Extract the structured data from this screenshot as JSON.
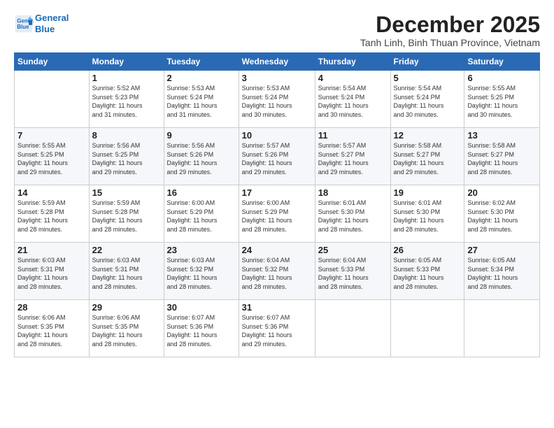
{
  "header": {
    "logo_line1": "General",
    "logo_line2": "Blue",
    "month": "December 2025",
    "location": "Tanh Linh, Binh Thuan Province, Vietnam"
  },
  "days_of_week": [
    "Sunday",
    "Monday",
    "Tuesday",
    "Wednesday",
    "Thursday",
    "Friday",
    "Saturday"
  ],
  "weeks": [
    [
      {
        "num": "",
        "info": ""
      },
      {
        "num": "1",
        "info": "Sunrise: 5:52 AM\nSunset: 5:23 PM\nDaylight: 11 hours\nand 31 minutes."
      },
      {
        "num": "2",
        "info": "Sunrise: 5:53 AM\nSunset: 5:24 PM\nDaylight: 11 hours\nand 31 minutes."
      },
      {
        "num": "3",
        "info": "Sunrise: 5:53 AM\nSunset: 5:24 PM\nDaylight: 11 hours\nand 30 minutes."
      },
      {
        "num": "4",
        "info": "Sunrise: 5:54 AM\nSunset: 5:24 PM\nDaylight: 11 hours\nand 30 minutes."
      },
      {
        "num": "5",
        "info": "Sunrise: 5:54 AM\nSunset: 5:24 PM\nDaylight: 11 hours\nand 30 minutes."
      },
      {
        "num": "6",
        "info": "Sunrise: 5:55 AM\nSunset: 5:25 PM\nDaylight: 11 hours\nand 30 minutes."
      }
    ],
    [
      {
        "num": "7",
        "info": "Sunrise: 5:55 AM\nSunset: 5:25 PM\nDaylight: 11 hours\nand 29 minutes."
      },
      {
        "num": "8",
        "info": "Sunrise: 5:56 AM\nSunset: 5:25 PM\nDaylight: 11 hours\nand 29 minutes."
      },
      {
        "num": "9",
        "info": "Sunrise: 5:56 AM\nSunset: 5:26 PM\nDaylight: 11 hours\nand 29 minutes."
      },
      {
        "num": "10",
        "info": "Sunrise: 5:57 AM\nSunset: 5:26 PM\nDaylight: 11 hours\nand 29 minutes."
      },
      {
        "num": "11",
        "info": "Sunrise: 5:57 AM\nSunset: 5:27 PM\nDaylight: 11 hours\nand 29 minutes."
      },
      {
        "num": "12",
        "info": "Sunrise: 5:58 AM\nSunset: 5:27 PM\nDaylight: 11 hours\nand 29 minutes."
      },
      {
        "num": "13",
        "info": "Sunrise: 5:58 AM\nSunset: 5:27 PM\nDaylight: 11 hours\nand 28 minutes."
      }
    ],
    [
      {
        "num": "14",
        "info": "Sunrise: 5:59 AM\nSunset: 5:28 PM\nDaylight: 11 hours\nand 28 minutes."
      },
      {
        "num": "15",
        "info": "Sunrise: 5:59 AM\nSunset: 5:28 PM\nDaylight: 11 hours\nand 28 minutes."
      },
      {
        "num": "16",
        "info": "Sunrise: 6:00 AM\nSunset: 5:29 PM\nDaylight: 11 hours\nand 28 minutes."
      },
      {
        "num": "17",
        "info": "Sunrise: 6:00 AM\nSunset: 5:29 PM\nDaylight: 11 hours\nand 28 minutes."
      },
      {
        "num": "18",
        "info": "Sunrise: 6:01 AM\nSunset: 5:30 PM\nDaylight: 11 hours\nand 28 minutes."
      },
      {
        "num": "19",
        "info": "Sunrise: 6:01 AM\nSunset: 5:30 PM\nDaylight: 11 hours\nand 28 minutes."
      },
      {
        "num": "20",
        "info": "Sunrise: 6:02 AM\nSunset: 5:30 PM\nDaylight: 11 hours\nand 28 minutes."
      }
    ],
    [
      {
        "num": "21",
        "info": "Sunrise: 6:03 AM\nSunset: 5:31 PM\nDaylight: 11 hours\nand 28 minutes."
      },
      {
        "num": "22",
        "info": "Sunrise: 6:03 AM\nSunset: 5:31 PM\nDaylight: 11 hours\nand 28 minutes."
      },
      {
        "num": "23",
        "info": "Sunrise: 6:03 AM\nSunset: 5:32 PM\nDaylight: 11 hours\nand 28 minutes."
      },
      {
        "num": "24",
        "info": "Sunrise: 6:04 AM\nSunset: 5:32 PM\nDaylight: 11 hours\nand 28 minutes."
      },
      {
        "num": "25",
        "info": "Sunrise: 6:04 AM\nSunset: 5:33 PM\nDaylight: 11 hours\nand 28 minutes."
      },
      {
        "num": "26",
        "info": "Sunrise: 6:05 AM\nSunset: 5:33 PM\nDaylight: 11 hours\nand 28 minutes."
      },
      {
        "num": "27",
        "info": "Sunrise: 6:05 AM\nSunset: 5:34 PM\nDaylight: 11 hours\nand 28 minutes."
      }
    ],
    [
      {
        "num": "28",
        "info": "Sunrise: 6:06 AM\nSunset: 5:35 PM\nDaylight: 11 hours\nand 28 minutes."
      },
      {
        "num": "29",
        "info": "Sunrise: 6:06 AM\nSunset: 5:35 PM\nDaylight: 11 hours\nand 28 minutes."
      },
      {
        "num": "30",
        "info": "Sunrise: 6:07 AM\nSunset: 5:36 PM\nDaylight: 11 hours\nand 28 minutes."
      },
      {
        "num": "31",
        "info": "Sunrise: 6:07 AM\nSunset: 5:36 PM\nDaylight: 11 hours\nand 29 minutes."
      },
      {
        "num": "",
        "info": ""
      },
      {
        "num": "",
        "info": ""
      },
      {
        "num": "",
        "info": ""
      }
    ]
  ]
}
